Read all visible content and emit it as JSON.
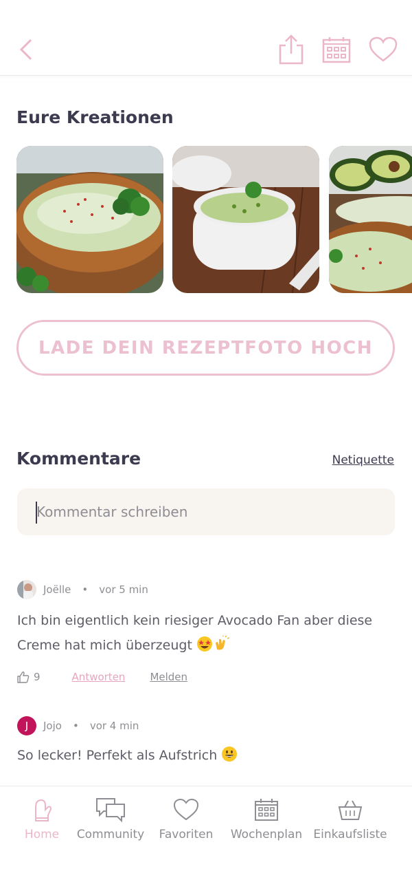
{
  "header": {
    "back_icon": "chevron-left-icon",
    "share_icon": "share-icon",
    "plan_icon": "calendar-icon",
    "favorite_icon": "heart-icon"
  },
  "gallery": {
    "title": "Eure Kreationen",
    "photos": [
      "photo-1",
      "photo-2",
      "photo-3"
    ]
  },
  "upload": {
    "label": "LADE DEIN REZEPTFOTO HOCH"
  },
  "comments_section": {
    "title": "Kommentare",
    "netiquette": "Netiquette",
    "input_placeholder": "Kommentar schreiben"
  },
  "comments": [
    {
      "author": "Joëlle",
      "separator": "•",
      "time": "vor 5 min",
      "text": "Ich bin eigentlich kein riesiger Avocado Fan aber diese Creme hat mich überzeugt",
      "likes": "9",
      "reply": "Antworten",
      "report": "Melden"
    },
    {
      "author": "Jojo",
      "avatar_letter": "J",
      "separator": "•",
      "time": "vor 4 min",
      "text": "So lecker! Perfekt als Aufstrich"
    }
  ],
  "nav": {
    "items": [
      {
        "label": "Home",
        "icon": "home-oven-mitt-icon",
        "active": true
      },
      {
        "label": "Community",
        "icon": "chat-bubbles-icon"
      },
      {
        "label": "Favoriten",
        "icon": "heart-icon"
      },
      {
        "label": "Wochenplan",
        "icon": "calendar-icon"
      },
      {
        "label": "Einkaufsliste",
        "icon": "basket-icon"
      }
    ]
  },
  "colors": {
    "accent_pink": "#ecc0d0",
    "text_dark": "#3b3a4f",
    "text_muted": "#8e8d93",
    "input_bg": "#f8f4f0",
    "avatar_jojo": "#c1145a"
  }
}
